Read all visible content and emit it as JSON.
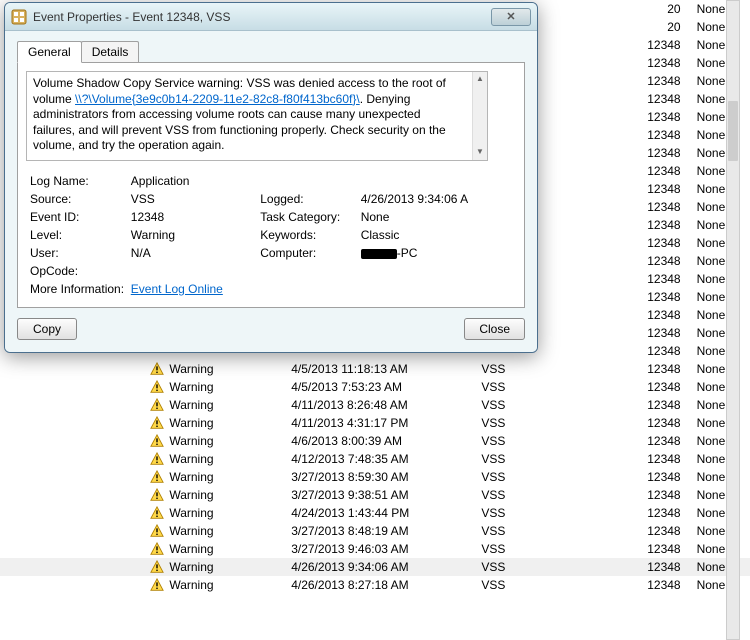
{
  "dialog": {
    "title": "Event Properties - Event 12348, VSS",
    "tabs": {
      "general": "General",
      "details": "Details"
    },
    "description": {
      "pre": "Volume Shadow Copy Service warning: VSS was denied access to the root of volume ",
      "link": "\\\\?\\Volume{3e9c0b14-2209-11e2-82c8-f80f413bc60f}\\",
      "post": ". Denying administrators from accessing volume roots can cause many unexpected failures, and will prevent VSS from functioning properly.  Check security on the volume, and try the operation again."
    },
    "labels": {
      "logname": "Log Name:",
      "source": "Source:",
      "eventid": "Event ID:",
      "level": "Level:",
      "user": "User:",
      "opcode": "OpCode:",
      "moreinfo": "More Information:",
      "logged": "Logged:",
      "taskcat": "Task Category:",
      "keywords": "Keywords:",
      "computer": "Computer:"
    },
    "values": {
      "logname": "Application",
      "source": "VSS",
      "eventid": "12348",
      "level": "Warning",
      "user": "N/A",
      "opcode": "",
      "logged": "4/26/2013 9:34:06 A",
      "taskcat": "None",
      "keywords": "Classic",
      "computer_suffix": "-PC",
      "moreinfo_link": "Event Log Online "
    },
    "buttons": {
      "copy": "Copy",
      "close": "Close"
    }
  },
  "bg_events": {
    "top_rows": [
      {
        "eventid": "20",
        "task": "None"
      },
      {
        "eventid": "20",
        "task": "None"
      },
      {
        "eventid": "12348",
        "task": "None"
      },
      {
        "eventid": "12348",
        "task": "None"
      },
      {
        "eventid": "12348",
        "task": "None"
      },
      {
        "eventid": "12348",
        "task": "None"
      },
      {
        "eventid": "12348",
        "task": "None"
      },
      {
        "eventid": "12348",
        "task": "None"
      },
      {
        "eventid": "12348",
        "task": "None"
      },
      {
        "eventid": "12348",
        "task": "None"
      },
      {
        "eventid": "12348",
        "task": "None"
      },
      {
        "eventid": "12348",
        "task": "None"
      },
      {
        "eventid": "12348",
        "task": "None"
      },
      {
        "eventid": "12348",
        "task": "None"
      },
      {
        "eventid": "12348",
        "task": "None"
      },
      {
        "eventid": "12348",
        "task": "None"
      },
      {
        "eventid": "12348",
        "task": "None"
      },
      {
        "eventid": "12348",
        "task": "None"
      },
      {
        "eventid": "12348",
        "task": "None"
      },
      {
        "eventid": "12348",
        "task": "None"
      }
    ],
    "full_rows": [
      {
        "level": "Warning",
        "date": "4/5/2013 11:18:13 AM",
        "source": "VSS",
        "eventid": "12348",
        "task": "None"
      },
      {
        "level": "Warning",
        "date": "4/5/2013 7:53:23 AM",
        "source": "VSS",
        "eventid": "12348",
        "task": "None"
      },
      {
        "level": "Warning",
        "date": "4/11/2013 8:26:48 AM",
        "source": "VSS",
        "eventid": "12348",
        "task": "None"
      },
      {
        "level": "Warning",
        "date": "4/11/2013 4:31:17 PM",
        "source": "VSS",
        "eventid": "12348",
        "task": "None"
      },
      {
        "level": "Warning",
        "date": "4/6/2013 8:00:39 AM",
        "source": "VSS",
        "eventid": "12348",
        "task": "None"
      },
      {
        "level": "Warning",
        "date": "4/12/2013 7:48:35 AM",
        "source": "VSS",
        "eventid": "12348",
        "task": "None"
      },
      {
        "level": "Warning",
        "date": "3/27/2013 8:59:30 AM",
        "source": "VSS",
        "eventid": "12348",
        "task": "None"
      },
      {
        "level": "Warning",
        "date": "3/27/2013 9:38:51 AM",
        "source": "VSS",
        "eventid": "12348",
        "task": "None"
      },
      {
        "level": "Warning",
        "date": "4/24/2013 1:43:44 PM",
        "source": "VSS",
        "eventid": "12348",
        "task": "None"
      },
      {
        "level": "Warning",
        "date": "3/27/2013 8:48:19 AM",
        "source": "VSS",
        "eventid": "12348",
        "task": "None"
      },
      {
        "level": "Warning",
        "date": "3/27/2013 9:46:03 AM",
        "source": "VSS",
        "eventid": "12348",
        "task": "None"
      },
      {
        "level": "Warning",
        "date": "4/26/2013 9:34:06 AM",
        "source": "VSS",
        "eventid": "12348",
        "task": "None",
        "selected": true
      },
      {
        "level": "Warning",
        "date": "4/26/2013 8:27:18 AM",
        "source": "VSS",
        "eventid": "12348",
        "task": "None"
      }
    ]
  }
}
